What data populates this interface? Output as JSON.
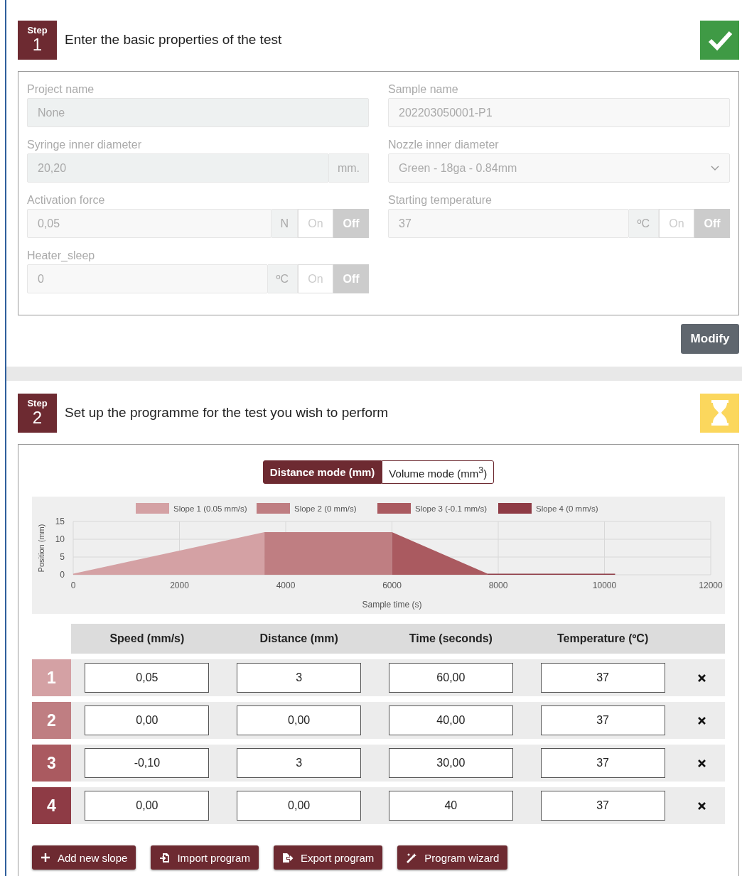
{
  "steps": [
    {
      "label": "Step",
      "number": "1",
      "title": "Enter the basic properties of the test",
      "complete": true
    },
    {
      "label": "Step",
      "number": "2",
      "title": "Set up the programme for the test you wish to perform",
      "complete": false
    }
  ],
  "properties": {
    "fields": [
      {
        "kind": "input",
        "label": "Project name",
        "value": "None"
      },
      {
        "kind": "input",
        "label": "Sample name",
        "value": "202203050001-P1"
      },
      {
        "kind": "input",
        "label": "Syringe inner diameter",
        "value": "20,20",
        "unit": "mm."
      },
      {
        "kind": "select",
        "label": "Nozzle inner diameter",
        "value": "Green - 18ga - 0.84mm"
      },
      {
        "kind": "input",
        "label": "Activation force",
        "value": "0,05",
        "unit": "N",
        "toggle": {
          "on_label": "On",
          "off_label": "Off",
          "on": false
        }
      },
      {
        "kind": "input",
        "label": "Starting temperature",
        "value": "37",
        "unit": "ºC",
        "toggle": {
          "on_label": "On",
          "off_label": "Off",
          "on": false
        }
      },
      {
        "kind": "input",
        "label": "Heater_sleep",
        "value": "0",
        "unit": "ºC",
        "toggle": {
          "on_label": "On",
          "off_label": "Off",
          "on": false
        }
      }
    ],
    "modify_button": "Modify"
  },
  "program": {
    "modes": [
      {
        "label": "Distance mode (mm)",
        "selected": true
      },
      {
        "label": "Volume mode (mm$^{3}$)",
        "selected": false
      }
    ],
    "chart_data": {
      "type": "area",
      "xlabel": "Sample time (s)",
      "ylabel": "Position (mm)",
      "x": [
        0,
        3600,
        6000,
        7800,
        10200
      ],
      "series": [
        {
          "name": "Slope 1 (0.05 mm/s)",
          "color": "#d4a1a4",
          "values": [
            0,
            12,
            null,
            null,
            null
          ]
        },
        {
          "name": "Slope 2 (0 mm/s)",
          "color": "#bf7e82",
          "values": [
            null,
            12,
            12,
            null,
            null
          ]
        },
        {
          "name": "Slope 3 (-0.1 mm/s)",
          "color": "#aa5a60",
          "values": [
            null,
            null,
            12,
            0,
            null
          ]
        },
        {
          "name": "Slope 4 (0 mm/s)",
          "color": "#8e3b45",
          "values": [
            null,
            null,
            null,
            0,
            0
          ]
        }
      ],
      "grid": true,
      "legend": "top",
      "xlim": [
        0,
        12000
      ],
      "ylim": [
        0,
        15
      ],
      "xticks": [
        0,
        2000,
        4000,
        6000,
        8000,
        10000,
        12000
      ],
      "yticks": [
        0,
        5,
        10,
        15
      ]
    },
    "columns": [
      "Speed (mm/s)",
      "Distance (mm)",
      "Time (seconds)",
      "Temperature (ºC)"
    ],
    "rows": [
      {
        "number": "1",
        "color": "#d4a1a4",
        "values": [
          "0,05",
          "3",
          "60,00",
          "37"
        ]
      },
      {
        "number": "2",
        "color": "#bf7e82",
        "values": [
          "0,00",
          "0,00",
          "40,00",
          "37"
        ]
      },
      {
        "number": "3",
        "color": "#aa5a60",
        "values": [
          "-0,10",
          "3",
          "30,00",
          "37"
        ]
      },
      {
        "number": "4",
        "color": "#8e3b45",
        "values": [
          "0,00",
          "0,00",
          "40",
          "37"
        ]
      }
    ],
    "actions": [
      {
        "kind": "add",
        "label": "Add new slope"
      },
      {
        "kind": "import",
        "label": "Import program"
      },
      {
        "kind": "export",
        "label": "Export program"
      },
      {
        "kind": "wizard",
        "label": "Program wizard"
      }
    ]
  }
}
